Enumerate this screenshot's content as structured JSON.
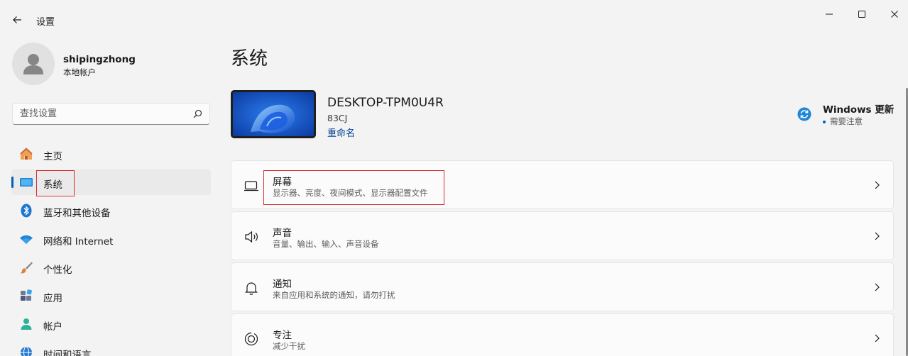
{
  "window": {
    "title": "设置",
    "back_icon": "back-arrow-icon",
    "minimize_icon": "minimize-icon",
    "maximize_icon": "maximize-icon",
    "close_icon": "close-icon"
  },
  "user": {
    "name": "shipingzhong",
    "account_type": "本地帐户"
  },
  "search": {
    "placeholder": "查找设置",
    "icon": "search-icon"
  },
  "sidebar": {
    "items": [
      {
        "label": "主页",
        "icon": "home-icon",
        "active": false
      },
      {
        "label": "系统",
        "icon": "system-icon",
        "active": true
      },
      {
        "label": "蓝牙和其他设备",
        "icon": "bluetooth-icon",
        "active": false
      },
      {
        "label": "网络和 Internet",
        "icon": "wifi-icon",
        "active": false
      },
      {
        "label": "个性化",
        "icon": "brush-icon",
        "active": false
      },
      {
        "label": "应用",
        "icon": "apps-icon",
        "active": false
      },
      {
        "label": "帐户",
        "icon": "account-icon",
        "active": false
      },
      {
        "label": "时间和语言",
        "icon": "globe-icon",
        "active": false
      }
    ]
  },
  "main": {
    "title": "系统",
    "device": {
      "name": "DESKTOP-TPM0U4R",
      "model": "83CJ",
      "rename_label": "重命名"
    },
    "windows_update": {
      "title": "Windows 更新",
      "status": "需要注意",
      "icon": "refresh-icon"
    },
    "cards": [
      {
        "title": "屏幕",
        "subtitle": "显示器、亮度、夜间模式、显示器配置文件",
        "icon": "monitor-icon"
      },
      {
        "title": "声音",
        "subtitle": "音量、输出、输入、声音设备",
        "icon": "speaker-icon"
      },
      {
        "title": "通知",
        "subtitle": "来自应用和系统的通知，请勿打扰",
        "icon": "bell-icon"
      },
      {
        "title": "专注",
        "subtitle": "减少干扰",
        "icon": "focus-icon"
      }
    ]
  },
  "colors": {
    "accent": "#005fb8",
    "annotation_red": "#d62b2b",
    "background": "#f3f3f3"
  }
}
